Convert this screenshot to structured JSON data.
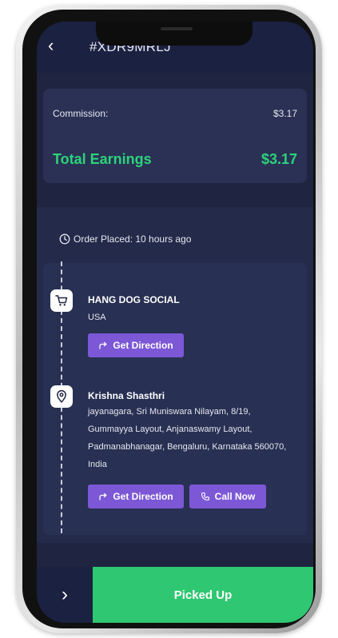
{
  "header": {
    "back_glyph": "‹",
    "order_id": "#XDR9MRLJ"
  },
  "earnings": {
    "commission_label": "Commission:",
    "commission_value": "$3.17",
    "total_label": "Total Earnings",
    "total_value": "$3.17",
    "accent_color": "#2cd37a"
  },
  "order_placed": "Order Placed: 10 hours ago",
  "pickup": {
    "name": "HANG DOG SOCIAL",
    "address": "USA",
    "direction_label": "Get Direction",
    "icon": "cart-icon"
  },
  "dropoff": {
    "name": "Krishna Shasthri",
    "address": "jayanagara, Sri Muniswara Nilayam, 8/19, Gummayya Layout, Anjanaswamy Layout, Padmanabhanagar, Bengaluru, Karnataka 560070, India",
    "direction_label": "Get Direction",
    "call_label": "Call Now",
    "icon": "map-pin-icon"
  },
  "footer": {
    "arrow_glyph": "›",
    "action_label": "Picked Up",
    "action_color": "#2fc771"
  }
}
